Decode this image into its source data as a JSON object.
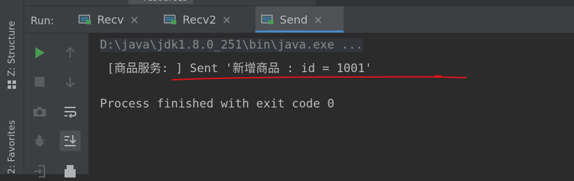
{
  "left_strip": {
    "structure_label": "Z: Structure",
    "favorites_label": "2: Favorites"
  },
  "top_fragment": {
    "tab_label": "resources"
  },
  "run_bar": {
    "run_label": "Run:",
    "tabs": [
      {
        "label": "Recv",
        "active": false
      },
      {
        "label": "Recv2",
        "active": false
      },
      {
        "label": "Send",
        "active": true
      }
    ],
    "close_glyph": "×"
  },
  "toolbar": {
    "icons": [
      "run-icon",
      "scroll-up-icon",
      "stop-icon",
      "scroll-down-icon",
      "camera-icon",
      "soft-wrap-icon",
      "debug-bug-icon",
      "scroll-to-end-icon",
      "login-icon",
      "print-icon"
    ],
    "selected": "scroll-to-end-icon"
  },
  "console": {
    "command_line": "D:\\java\\jdk1.8.0_251\\bin\\java.exe ...",
    "output_line": " [商品服务: ] Sent '新增商品 : id = 1001'",
    "exit_line": "Process finished with exit code 0"
  },
  "colors": {
    "background": "#2b2b2b",
    "panel": "#3c3f41",
    "active_tab": "#4e5254",
    "accent": "#4a88c7",
    "run_green": "#499c54",
    "annotation_red": "#e0141a"
  }
}
